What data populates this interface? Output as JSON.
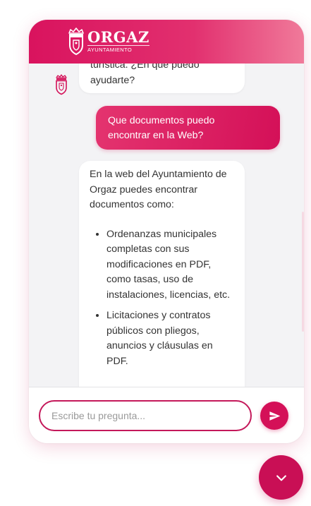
{
  "brand": {
    "name": "ORGAZ",
    "subtitle": "AYUNTAMIENTO",
    "primary_color": "#d41058",
    "header_gradient_end": "#f07a9a"
  },
  "messages": [
    {
      "role": "bot",
      "lines": [
        "turística. ¿En qué puedo",
        "ayudarte?"
      ]
    },
    {
      "role": "user",
      "lines": [
        "Que documentos puedo",
        "encontrar en la Web?"
      ]
    },
    {
      "role": "bot",
      "intro": "En la web del Ayuntamiento de Orgaz puedes encontrar documentos como:",
      "items": [
        "Ordenanzas municipales completas con sus modificaciones en PDF, como tasas, uso de instalaciones, licencias, etc.",
        "Licitaciones y contratos públicos con pliegos, anuncios y cláusulas en PDF."
      ]
    }
  ],
  "composer": {
    "placeholder": "Escribe tu pregunta...",
    "send_icon": "send-icon"
  },
  "toggle_icon": "chevron-down-icon"
}
